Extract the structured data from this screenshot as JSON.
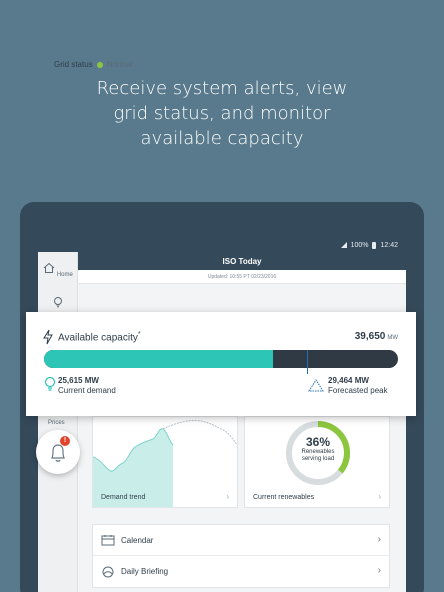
{
  "headline": {
    "line1": "Receive system alerts, view",
    "line2": "grid status, and monitor",
    "line3": "available capacity"
  },
  "status_bar": {
    "battery": "100%",
    "time": "12:42"
  },
  "app": {
    "title": "ISO Today"
  },
  "updated": "Updated: 10:55 PT 02/23/2016",
  "sidebar": {
    "home_label": "Home",
    "prices_label": "Prices"
  },
  "grid_status": {
    "label": "Grid status",
    "value": "Normal",
    "color": "#8cc63f"
  },
  "capacity": {
    "title": "Available capacity",
    "asterisk": "*",
    "value": "39,650",
    "unit": "MW",
    "demand_fraction": 0.646,
    "peak_fraction": 0.743,
    "current_demand_value": "25,615 MW",
    "current_demand_label": "Current demand",
    "forecast_peak_value": "29,464 MW",
    "forecast_peak_label": "Forecasted peak",
    "fill_color": "#2cc5b6",
    "track_color": "#2f3a44"
  },
  "alerts": {
    "badge": "!"
  },
  "tiles": {
    "demand_label": "Demand trend",
    "renewables_label": "Current renewables",
    "renewables_pct": "36%",
    "renewables_fraction": 0.36,
    "renewables_sub1": "Renewables",
    "renewables_sub2": "serving load"
  },
  "list": [
    {
      "label": "Calendar",
      "icon": "calendar-icon"
    },
    {
      "label": "Daily Briefing",
      "icon": "briefing-icon"
    }
  ]
}
